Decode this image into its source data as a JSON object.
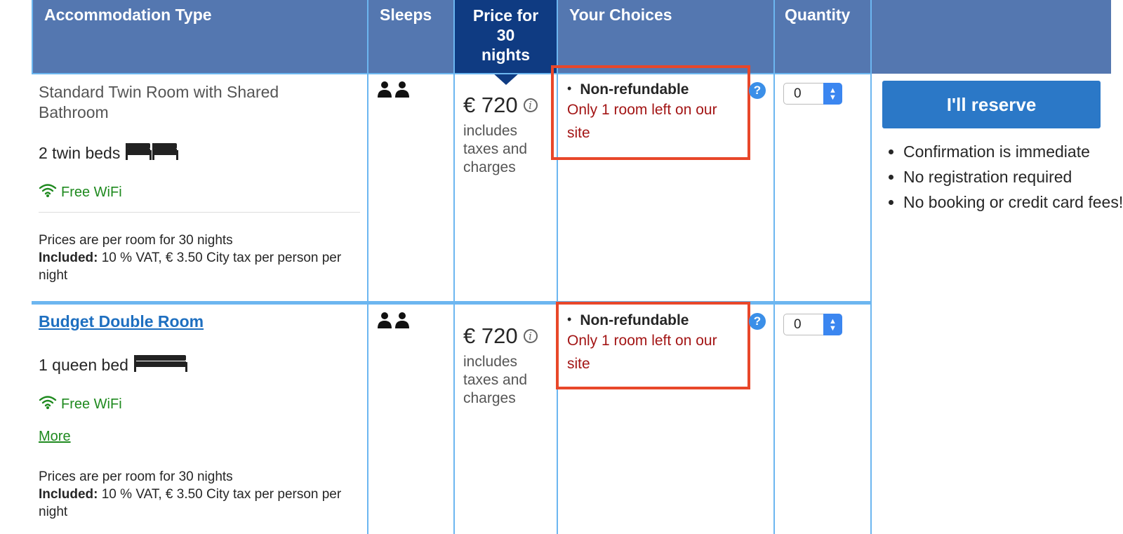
{
  "header": {
    "accommodation_type": "Accommodation Type",
    "sleeps": "Sleeps",
    "price_line1": "Price for",
    "price_line2": "30",
    "price_line3": "nights",
    "your_choices": "Your Choices",
    "quantity": "Quantity"
  },
  "rooms": [
    {
      "name": "Standard Twin Room with Shared Bathroom",
      "beds": "2 twin beds",
      "wifi": "Free WiFi",
      "prices_note": "Prices are per room for 30 nights",
      "included_label": "Included:",
      "included_text": "10 % VAT, € 3.50 City tax per person per night",
      "price": "€ 720",
      "taxes": "includes taxes and charges",
      "choice_title": "Non-refundable",
      "choice_warning": "Only 1 room left on our site",
      "quantity": "0"
    },
    {
      "name": "Budget Double Room",
      "beds": "1 queen bed",
      "wifi": "Free WiFi",
      "more": "More",
      "prices_note": "Prices are per room for 30 nights",
      "included_label": "Included:",
      "included_text": "10 % VAT, € 3.50 City tax per person per night",
      "price": "€ 720",
      "taxes": "includes taxes and charges",
      "choice_title": "Non-refundable",
      "choice_warning": "Only 1 room left on our site",
      "quantity": "0"
    }
  ],
  "reserve": {
    "button_label": "I'll reserve",
    "perks": [
      "Confirmation is immediate",
      "No registration required",
      "No booking or credit card fees!"
    ]
  },
  "colors": {
    "header_bg": "#5477b0",
    "price_header_bg": "#0f3b82",
    "grid_line": "#6cb6f0",
    "warning_red": "#a31515",
    "highlight_box": "#e8472a",
    "wifi_green": "#1f8a1f",
    "reserve_blue": "#2b78c7"
  },
  "icons": {
    "sleeps": "two-person-icon",
    "twin_beds": "twin-bed-icon",
    "queen_bed": "queen-bed-icon",
    "wifi": "wifi-icon",
    "info": "info-icon",
    "help": "question-icon",
    "stepper": "stepper-icon"
  }
}
